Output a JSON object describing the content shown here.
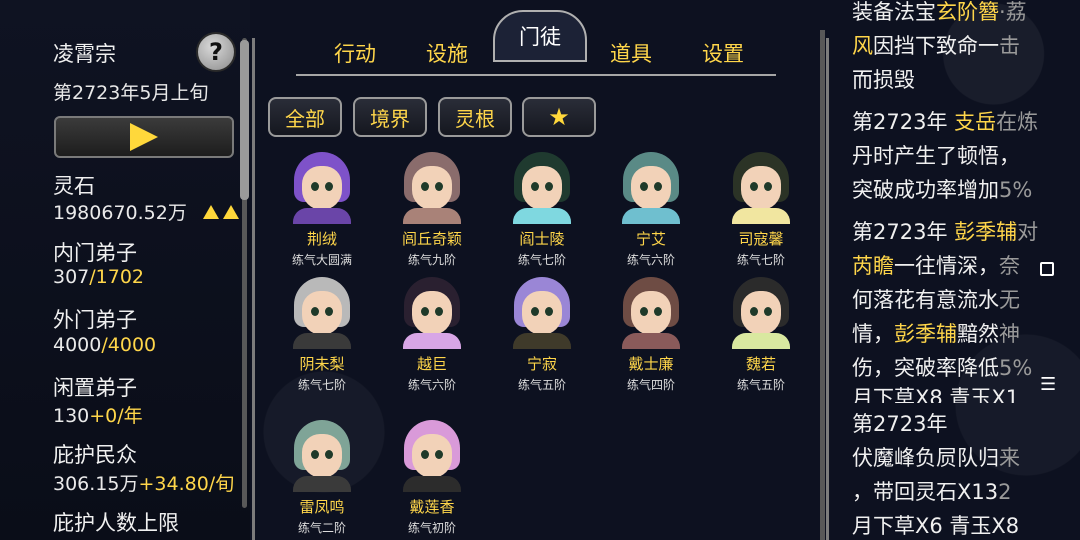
{
  "sect": {
    "name": "凌霄宗",
    "date": "第2723年5月上旬",
    "help_label": "?"
  },
  "stats": {
    "spirit_stone_label": "灵石",
    "spirit_stone_value": "1980670.52万",
    "inner_label": "内门弟子",
    "inner_current": "307",
    "inner_max": "/1702",
    "outer_label": "外门弟子",
    "outer_current": "4000",
    "outer_max": "/4000",
    "idle_label": "闲置弟子",
    "idle_value": "130",
    "idle_rate": "+0/年",
    "people_label": "庇护民众",
    "people_value": "306.15万",
    "people_rate": "+34.80/旬",
    "limit_label": "庇护人数上限"
  },
  "tabs": [
    "行动",
    "设施",
    "门徒",
    "道具",
    "设置"
  ],
  "active_tab": "门徒",
  "filters": [
    "全部",
    "境界",
    "灵根"
  ],
  "disciples": [
    {
      "name": "荆绒",
      "rank": "练气大圆满",
      "hair": "#7e52c9",
      "body": "#6a45a8"
    },
    {
      "name": "闾丘奇颖",
      "rank": "练气九阶",
      "hair": "#8a6c6c",
      "body": "#a98278"
    },
    {
      "name": "阎士陵",
      "rank": "练气七阶",
      "hair": "#1f3a2f",
      "body": "#7fd8e0"
    },
    {
      "name": "宁艾",
      "rank": "练气六阶",
      "hair": "#5a8a86",
      "body": "#6fbfcf"
    },
    {
      "name": "司寇馨",
      "rank": "练气七阶",
      "hair": "#2b3326",
      "body": "#f1e6a0"
    },
    {
      "name": "阴未梨",
      "rank": "练气七阶",
      "hair": "#b9b9b9",
      "body": "#3a3a3a"
    },
    {
      "name": "越巨",
      "rank": "练气六阶",
      "hair": "#2a2030",
      "body": "#d8a6e6"
    },
    {
      "name": "宁寂",
      "rank": "练气五阶",
      "hair": "#9a86d6",
      "body": "#3f3a2a"
    },
    {
      "name": "戴士廉",
      "rank": "练气四阶",
      "hair": "#6e4c44",
      "body": "#8a5a5a"
    },
    {
      "name": "魏若",
      "rank": "练气五阶",
      "hair": "#2b2b2b",
      "body": "#d9e8a0"
    },
    {
      "name": "雷凤鸣",
      "rank": "练气二阶",
      "hair": "#7fa497",
      "body": "#3a3a3a"
    },
    {
      "name": "戴莲香",
      "rank": "练气初阶",
      "hair": "#d99ad9",
      "body": "#2c2c2c"
    }
  ],
  "log": {
    "l1a": "装备法宝",
    "l1b": "玄阶簪",
    "l1c": "·荔",
    "l2a": "风",
    "l2b": "因挡下致命一",
    "l2c": "击",
    "l3": "而损毁",
    "e2_year": "第2723年 ",
    "e2_name": "支岳",
    "e2_t1": "在炼",
    "e2_t2": "丹时产生了顿悟，",
    "e2_t3": "突破成功率增加",
    "e2_t4": "5%",
    "e3_year": "第2723年 ",
    "e3_name": "彭季辅",
    "e3_t1": "对",
    "e3_name2": "芮瞻",
    "e3_t2": "一往情深，",
    "e3_t3": "奈",
    "e3_t4": "何落花有意流水",
    "e3_t5": "无",
    "e3_t6": "情，",
    "e3_name3": "彭季辅",
    "e3_t7": "黯然",
    "e3_t8": "神",
    "e3_t9": "伤，突破率降低",
    "e3_t10": "5%",
    "e3_t11": "月下草X8 青玉X1",
    "e4_year": "第2723年",
    "e4_t1": "伏魔峰负屃队归",
    "e4_t2": "来",
    "e4_t3": "，带回灵石X13",
    "e4_t4": "2",
    "e4_t5": "月下草X6 青玉X8"
  },
  "side_menu_label": "☰"
}
